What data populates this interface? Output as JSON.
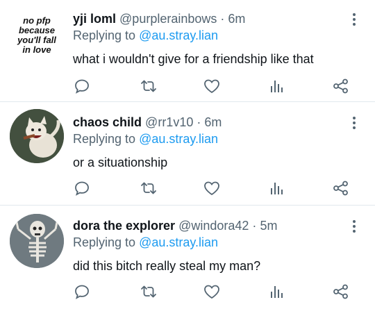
{
  "tweets": [
    {
      "name": "yji loml",
      "handle": "@purplerainbows",
      "dot": "·",
      "time": "6m",
      "replying_prefix": "Replying to ",
      "replying_to": "@au.stray.lian",
      "text": "what i wouldn't give for a friendship like that",
      "avatar_text": [
        "no pfp",
        "because",
        "you'll fall",
        "in love"
      ],
      "avatar": "text-avatar"
    },
    {
      "name": "chaos child",
      "handle": "@rr1v10",
      "dot": "·",
      "time": "6m",
      "replying_prefix": "Replying to ",
      "replying_to": "@au.stray.lian",
      "text": "or a situationship",
      "avatar": "cat-avatar"
    },
    {
      "name": "dora the explorer",
      "handle": "@windora42",
      "dot": "·",
      "time": "5m",
      "replying_prefix": "Replying to ",
      "replying_to": "@au.stray.lian",
      "text": "did this bitch really steal my man?",
      "avatar": "skeleton-avatar"
    }
  ],
  "action_icons": [
    "reply-icon",
    "retweet-icon",
    "like-icon",
    "views-icon",
    "share-icon"
  ],
  "colors": {
    "text": "#0f1419",
    "secondary": "#536471",
    "link": "#1d9bf0",
    "divider": "#e1e8ed"
  }
}
